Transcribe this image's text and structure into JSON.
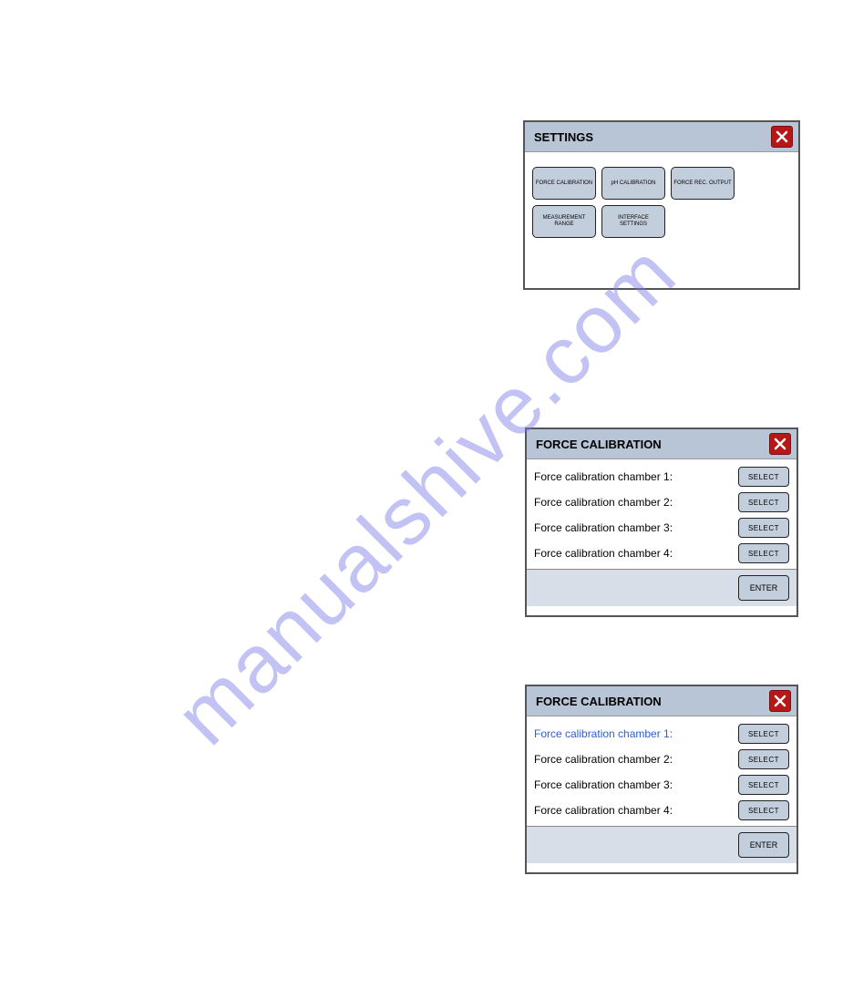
{
  "watermark": "manualshive.com",
  "settings": {
    "title": "SETTINGS",
    "buttons": {
      "force_calibration": "FORCE CALIBRATION",
      "ph_calibration": "pH CALIBRATION",
      "force_rec_output": "FORCE REC. OUTPUT",
      "measurement_range": "MEASUREMENT RANGE",
      "interface_settings": "INTERFACE SETTINGS"
    }
  },
  "force_cal": {
    "title": "FORCE CALIBRATION",
    "rows": {
      "r1": "Force calibration chamber 1:",
      "r2": "Force calibration chamber 2:",
      "r3": "Force calibration chamber 3:",
      "r4": "Force calibration chamber 4:"
    },
    "select_label": "SELECT",
    "enter_label": "ENTER"
  }
}
